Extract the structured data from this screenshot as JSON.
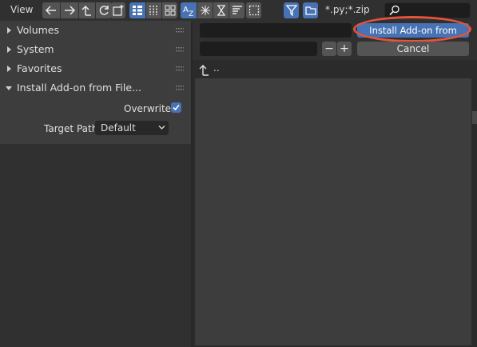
{
  "header": {
    "view_label": "View",
    "filter_glob": "*.py;*.zip",
    "search": {
      "value": "",
      "placeholder": ""
    },
    "icons": {
      "back": "arrow-left-icon",
      "forward": "arrow-right-icon",
      "parent": "parent-directory-icon",
      "refresh": "refresh-icon",
      "new_folder": "new-folder-icon",
      "vertical_list": "vertical-list-icon",
      "horizontal_list": "horizontal-list-icon",
      "thumbnails": "thumbnails-icon",
      "sort_alpha": "sort-alphabetical-icon",
      "sort_ext": "sort-extension-icon",
      "sort_time": "sort-time-icon",
      "sort_size": "sort-size-icon",
      "show_hidden": "show-hidden-icon",
      "filter": "filter-icon",
      "folder": "folder-icon",
      "search": "search-icon"
    }
  },
  "sidebar": {
    "sections": [
      {
        "label": "Volumes",
        "expanded": false
      },
      {
        "label": "System",
        "expanded": false
      },
      {
        "label": "Favorites",
        "expanded": false
      },
      {
        "label": "Install Add-on from File...",
        "expanded": true
      }
    ],
    "options": {
      "overwrite_label": "Overwrite",
      "overwrite_checked": true,
      "target_path_label": "Target Path",
      "target_path_value": "Default"
    }
  },
  "browser": {
    "directory_value": "",
    "filename_value": "",
    "decrement_label": "−",
    "increment_label": "+",
    "install_button_label": "Install Add-on from File...",
    "cancel_button_label": "Cancel",
    "parent_entry_label": ".."
  },
  "colors": {
    "accent": "#4772b3",
    "highlight_ring": "#e5533a",
    "panel": "#3d3d3d",
    "background": "#303030"
  }
}
